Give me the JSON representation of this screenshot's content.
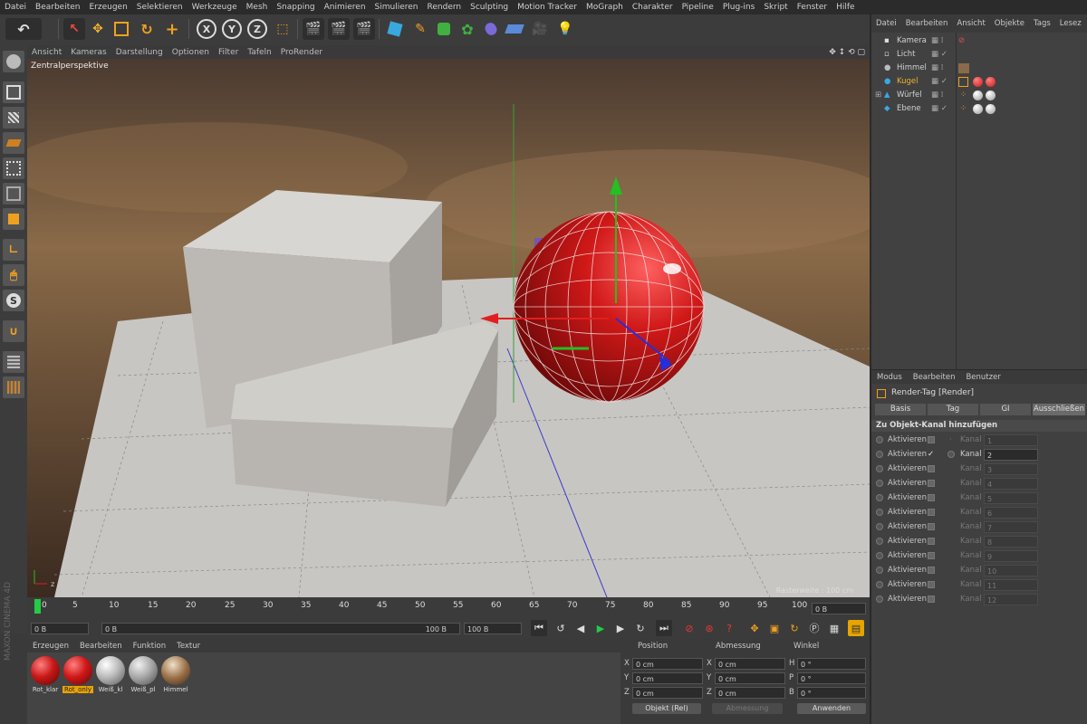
{
  "menu": [
    "Datei",
    "Bearbeiten",
    "Erzeugen",
    "Selektieren",
    "Werkzeuge",
    "Mesh",
    "Snapping",
    "Animieren",
    "Simulieren",
    "Rendern",
    "Sculpting",
    "Motion Tracker",
    "MoGraph",
    "Charakter",
    "Pipeline",
    "Plug-ins",
    "Skript",
    "Fenster",
    "Hilfe"
  ],
  "toolbar": {
    "x": "X",
    "y": "Y",
    "z": "Z"
  },
  "viewport": {
    "menu": [
      "Ansicht",
      "Kameras",
      "Darstellung",
      "Optionen",
      "Filter",
      "Tafeln",
      "ProRender"
    ],
    "label": "Zentralperspektive",
    "raster": "Rasterweite : 100 cm"
  },
  "timeline": {
    "ticks": [
      "0",
      "5",
      "10",
      "15",
      "20",
      "25",
      "30",
      "35",
      "40",
      "45",
      "50",
      "55",
      "60",
      "65",
      "70",
      "75",
      "80",
      "85",
      "90",
      "95",
      "100"
    ],
    "current_frame_field": "0 B"
  },
  "transport": {
    "start": "0 B",
    "scrub_start": "0 B",
    "scrub_end": "100 B",
    "end": "100 B"
  },
  "materials": {
    "menu": [
      "Erzeugen",
      "Bearbeiten",
      "Funktion",
      "Textur"
    ],
    "items": [
      {
        "name": "Rot_klar"
      },
      {
        "name": "Rot_only"
      },
      {
        "name": "Weiß_kl"
      },
      {
        "name": "Weiß_pl"
      },
      {
        "name": "Himmel"
      }
    ]
  },
  "coords": {
    "headers": [
      "Position",
      "Abmessung",
      "Winkel"
    ],
    "rows": [
      {
        "a": "X",
        "av": "0 cm",
        "b": "X",
        "bv": "0 cm",
        "c": "H",
        "cv": "0 °"
      },
      {
        "a": "Y",
        "av": "0 cm",
        "b": "Y",
        "bv": "0 cm",
        "c": "P",
        "cv": "0 °"
      },
      {
        "a": "Z",
        "av": "0 cm",
        "b": "Z",
        "bv": "0 cm",
        "c": "B",
        "cv": "0 °"
      }
    ],
    "mode": "Objekt (Rel)",
    "size_mode": "Abmessung",
    "apply": "Anwenden"
  },
  "objects": {
    "menu": [
      "Datei",
      "Bearbeiten",
      "Ansicht",
      "Objekte",
      "Tags",
      "Lesez"
    ],
    "items": [
      {
        "name": "Kamera"
      },
      {
        "name": "Licht"
      },
      {
        "name": "Himmel"
      },
      {
        "name": "Kugel"
      },
      {
        "name": "Würfel"
      },
      {
        "name": "Ebene"
      }
    ]
  },
  "attributes": {
    "menu": [
      "Modus",
      "Bearbeiten",
      "Benutzer"
    ],
    "title": "Render-Tag [Render]",
    "tabs": [
      "Basis",
      "Tag",
      "GI",
      "Ausschließen"
    ],
    "section": "Zu Objekt-Kanal hinzufügen",
    "rows": [
      {
        "label": "Aktivieren",
        "kanal": "Kanal",
        "value": "1"
      },
      {
        "label": "Aktivieren",
        "kanal": "Kanal",
        "value": "2"
      },
      {
        "label": "Aktivieren",
        "kanal": "Kanal",
        "value": "3"
      },
      {
        "label": "Aktivieren",
        "kanal": "Kanal",
        "value": "4"
      },
      {
        "label": "Aktivieren",
        "kanal": "Kanal",
        "value": "5"
      },
      {
        "label": "Aktivieren",
        "kanal": "Kanal",
        "value": "6"
      },
      {
        "label": "Aktivieren",
        "kanal": "Kanal",
        "value": "7"
      },
      {
        "label": "Aktivieren",
        "kanal": "Kanal",
        "value": "8"
      },
      {
        "label": "Aktivieren",
        "kanal": "Kanal",
        "value": "9"
      },
      {
        "label": "Aktivieren",
        "kanal": "Kanal",
        "value": "10"
      },
      {
        "label": "Aktivieren",
        "kanal": "Kanal",
        "value": "11"
      },
      {
        "label": "Aktivieren",
        "kanal": "Kanal",
        "value": "12"
      }
    ],
    "check_mark": "✓"
  },
  "brand": {
    "maxon": "MAXON",
    "product": "CINEMA 4D"
  },
  "colors": {
    "accent": "#f0a020",
    "selected": "#e8a400",
    "red_material": "#c81818"
  }
}
